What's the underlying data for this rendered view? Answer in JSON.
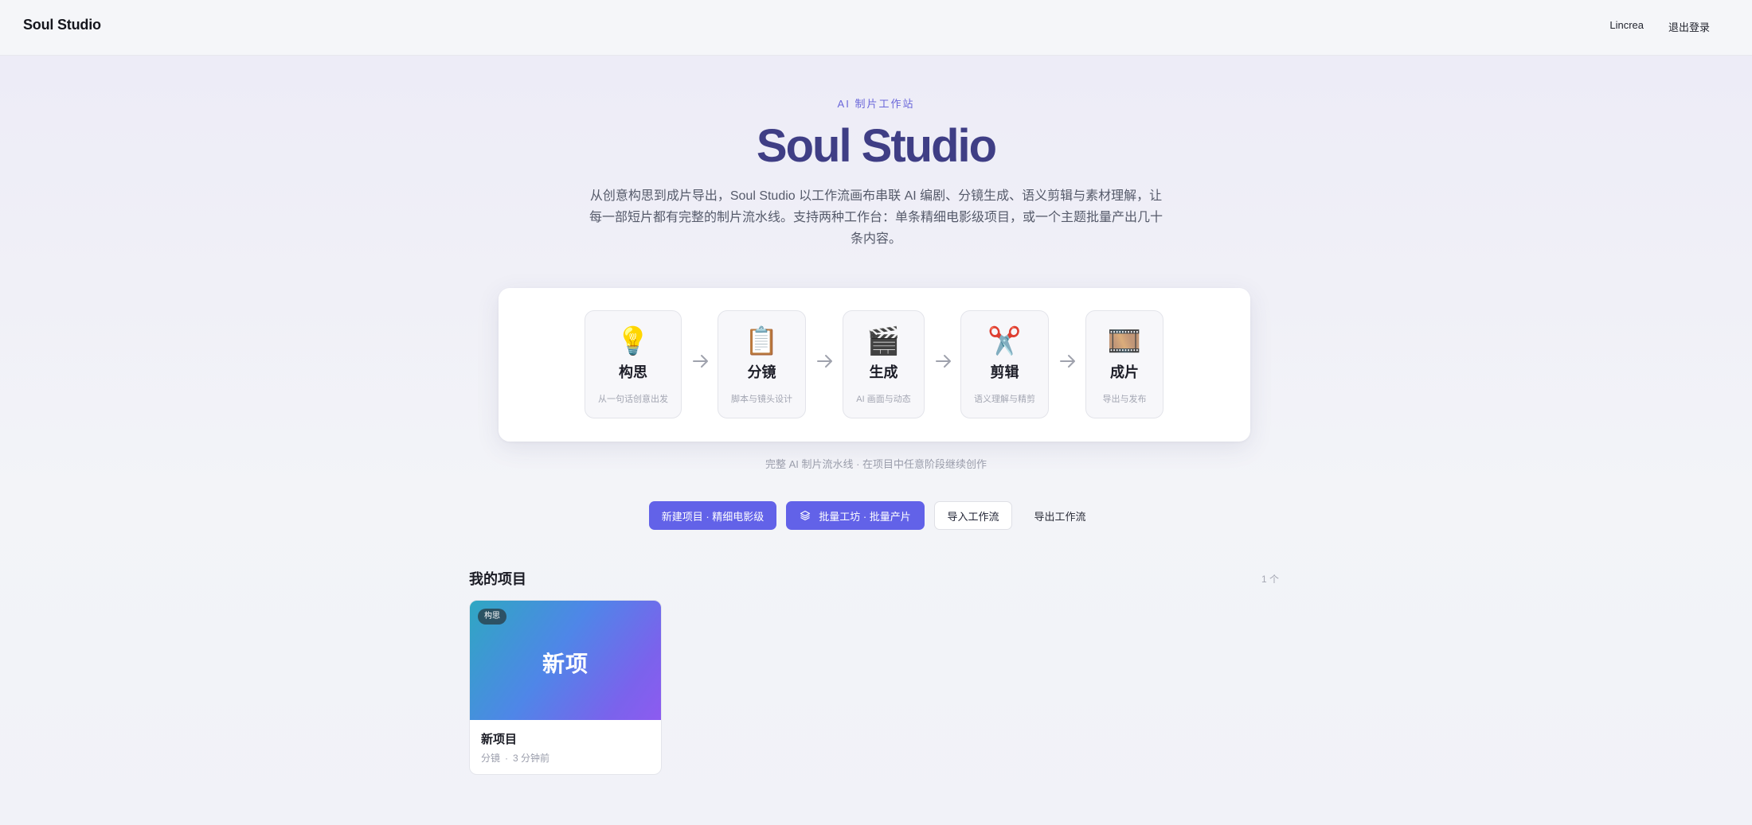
{
  "header": {
    "brand": "Soul Studio",
    "user": "Lincrea",
    "logout": "退出登录"
  },
  "hero": {
    "eyebrow": "AI 制片工作站",
    "title": "Soul Studio",
    "description": "从创意构思到成片导出，Soul Studio 以工作流画布串联 AI 编剧、分镜生成、语义剪辑与素材理解，让每一部短片都有完整的制片流水线。支持两种工作台：单条精细电影级项目，或一个主题批量产出几十条内容。"
  },
  "pipeline": {
    "stages": [
      {
        "icon": "lightbulb-icon",
        "glyph": "💡",
        "name": "构思",
        "sub": "从一句话创意出发"
      },
      {
        "icon": "clipboard-icon",
        "glyph": "📋",
        "name": "分镜",
        "sub": "脚本与镜头设计"
      },
      {
        "icon": "clapperboard-icon",
        "glyph": "🎬",
        "name": "生成",
        "sub": "AI 画面与动态"
      },
      {
        "icon": "scissors-icon",
        "glyph": "✂️",
        "name": "剪辑",
        "sub": "语义理解与精剪"
      },
      {
        "icon": "film-icon",
        "glyph": "🎞️",
        "name": "成片",
        "sub": "导出与发布"
      }
    ],
    "caption": "完整 AI 制片流水线 · 在项目中任意阶段继续创作"
  },
  "actions": {
    "new_project": "新建项目 · 精细电影级",
    "batch_workshop": "批量工坊 · 批量产片",
    "import_workflow": "导入工作流",
    "export_workflow": "导出工作流"
  },
  "projects": {
    "title": "我的项目",
    "count": "1 个",
    "items": [
      {
        "badge": "构思",
        "thumb_text": "新项",
        "name": "新项目",
        "stage": "分镜",
        "separator": "·",
        "time": "3 分钟前"
      }
    ]
  },
  "colors": {
    "accent": "#6262e8",
    "title": "#3f3e85",
    "eyebrow": "#6a66d9"
  }
}
